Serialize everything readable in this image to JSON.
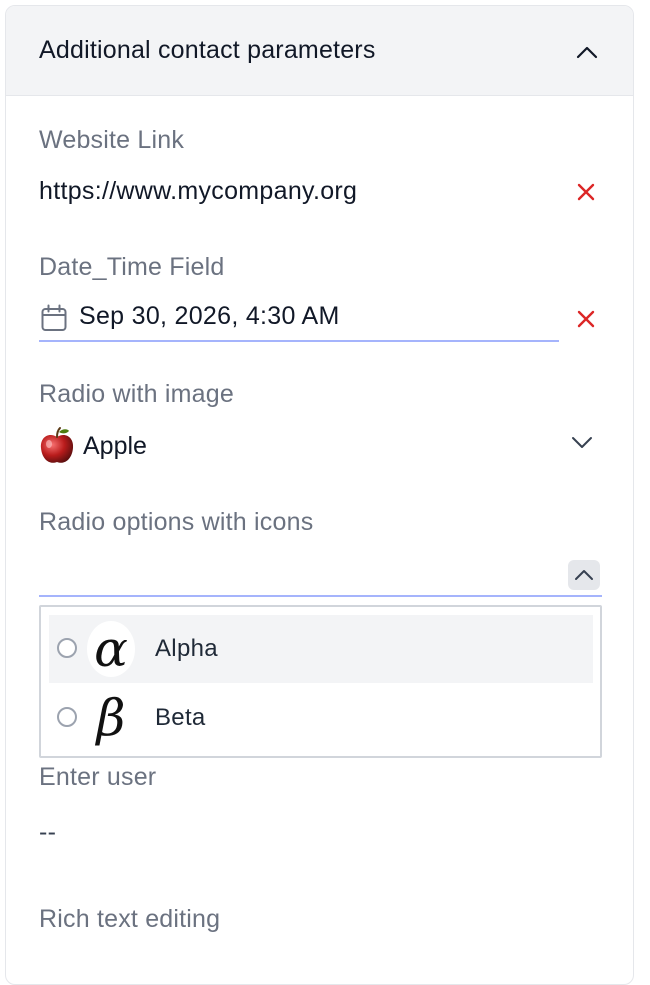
{
  "panel": {
    "title": "Additional contact parameters"
  },
  "fields": {
    "website": {
      "label": "Website Link",
      "value": "https://www.mycompany.org"
    },
    "datetime": {
      "label": "Date_Time Field",
      "value": "Sep 30, 2026, 4:30 AM"
    },
    "radio_image": {
      "label": "Radio with image",
      "value": "Apple"
    },
    "radio_icons": {
      "label": "Radio options with icons",
      "value": "",
      "options": [
        {
          "label": "Alpha",
          "glyph": "α",
          "icon": "alpha-icon"
        },
        {
          "label": "Beta",
          "glyph": "β",
          "icon": "beta-icon"
        }
      ]
    },
    "user": {
      "label": "Enter user",
      "value": "--"
    },
    "rich_text": {
      "label": "Rich text editing"
    }
  },
  "colors": {
    "clear": "#dc2626",
    "underline": "#a5b4fc",
    "label": "#6b7280",
    "header_bg": "#f3f4f6"
  }
}
